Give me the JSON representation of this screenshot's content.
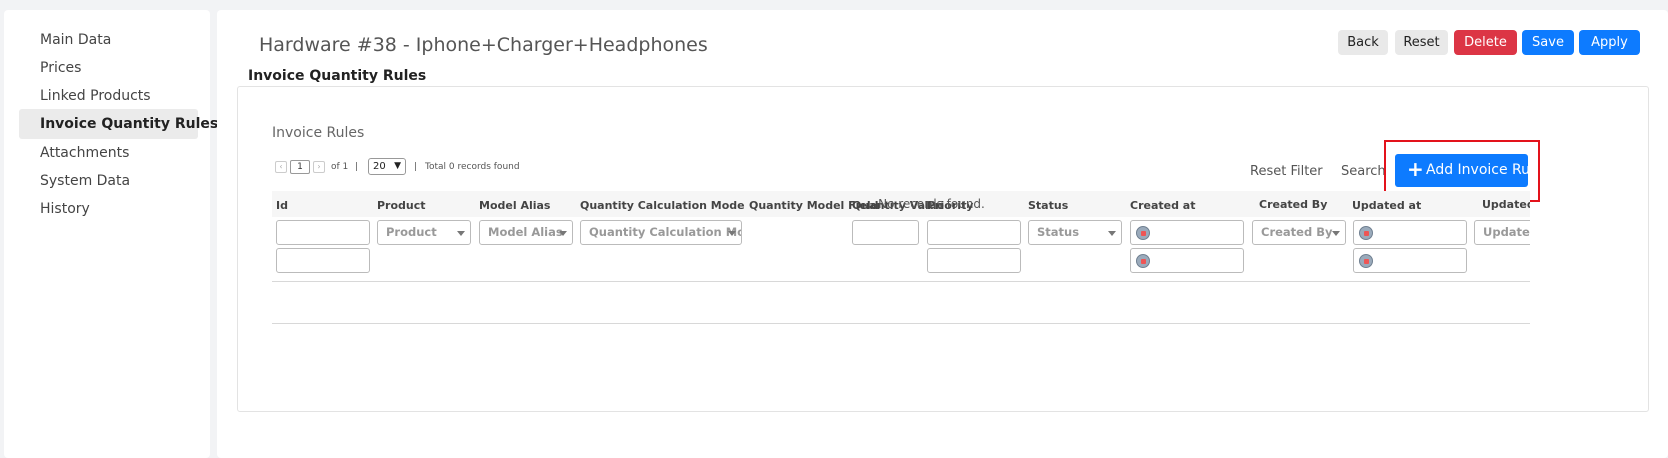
{
  "sidebar": {
    "items": [
      {
        "label": "Main Data"
      },
      {
        "label": "Prices"
      },
      {
        "label": "Linked Products"
      },
      {
        "label": "Invoice Quantity Rules"
      },
      {
        "label": "Attachments"
      },
      {
        "label": "System Data"
      },
      {
        "label": "History"
      }
    ],
    "active_index": 3
  },
  "header": {
    "title": "Hardware #38 - Iphone+Charger+Headphones",
    "section_title": "Invoice Quantity Rules",
    "buttons": {
      "back": "Back",
      "reset": "Reset",
      "delete": "Delete",
      "save": "Save",
      "apply": "Apply"
    }
  },
  "panel": {
    "title": "Invoice Rules",
    "pager": {
      "prev_icon": "chevron-left-icon",
      "page": "1",
      "next_icon": "chevron-right-icon",
      "of_text": "of 1",
      "sep1": "|",
      "page_size": "20",
      "sep2": "|",
      "total": "Total 0 records found"
    },
    "reset_filter": "Reset Filter",
    "search": "Search",
    "add_button": "Add Invoice Rule",
    "columns": [
      "Id",
      "Product",
      "Model Alias",
      "Quantity Calculation Mode",
      "Quantity Model Field",
      "Quantity Value",
      "Priority",
      "Status",
      "Created at",
      "Created By",
      "Updated at",
      "Updated B"
    ],
    "filters": {
      "product": "Product",
      "model_alias": "Model Alias",
      "qty_mode": "Quantity Calculation Mode",
      "status": "Status",
      "created_by": "Created By",
      "updated_by": "Updated I"
    },
    "empty_message": "No records found."
  },
  "colors": {
    "primary": "#0d7bff",
    "danger": "#dc3545",
    "highlight": "#e3121b"
  }
}
